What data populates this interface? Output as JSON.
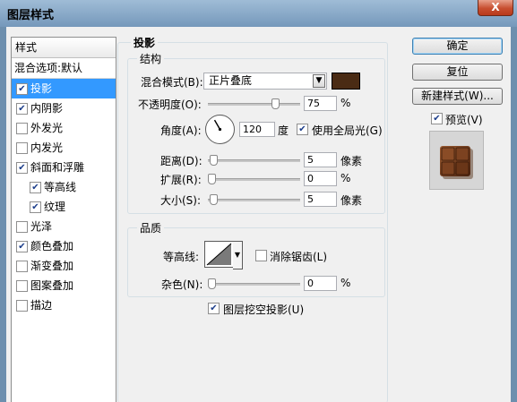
{
  "window": {
    "title": "图层样式",
    "close_label": "X"
  },
  "style_list": {
    "header": "样式",
    "blend": "混合选项:默认",
    "items": [
      {
        "label": "投影",
        "checked": true,
        "selected": true,
        "indent": false
      },
      {
        "label": "内阴影",
        "checked": true,
        "selected": false,
        "indent": false
      },
      {
        "label": "外发光",
        "checked": false,
        "selected": false,
        "indent": false
      },
      {
        "label": "内发光",
        "checked": false,
        "selected": false,
        "indent": false
      },
      {
        "label": "斜面和浮雕",
        "checked": true,
        "selected": false,
        "indent": false
      },
      {
        "label": "等高线",
        "checked": true,
        "selected": false,
        "indent": true
      },
      {
        "label": "纹理",
        "checked": true,
        "selected": false,
        "indent": true
      },
      {
        "label": "光泽",
        "checked": false,
        "selected": false,
        "indent": false
      },
      {
        "label": "颜色叠加",
        "checked": true,
        "selected": false,
        "indent": false
      },
      {
        "label": "渐变叠加",
        "checked": false,
        "selected": false,
        "indent": false
      },
      {
        "label": "图案叠加",
        "checked": false,
        "selected": false,
        "indent": false
      },
      {
        "label": "描边",
        "checked": false,
        "selected": false,
        "indent": false
      }
    ]
  },
  "drop_shadow": {
    "title": "投影",
    "structure": {
      "title": "结构",
      "blend_mode_label": "混合模式(B):",
      "blend_mode_value": "正片叠底",
      "shadow_color": "#4a2b14",
      "opacity_label": "不透明度(O):",
      "opacity_value": "75",
      "opacity_unit": "%",
      "opacity_fraction": 0.75,
      "angle_label": "角度(A):",
      "angle_value": "120",
      "angle_unit": "度",
      "use_global_light_label": "使用全局光(G)",
      "use_global_light": true,
      "distance_label": "距离(D):",
      "distance_value": "5",
      "distance_unit": "像素",
      "distance_fraction": 0.02,
      "spread_label": "扩展(R):",
      "spread_value": "0",
      "spread_unit": "%",
      "spread_fraction": 0,
      "size_label": "大小(S):",
      "size_value": "5",
      "size_unit": "像素",
      "size_fraction": 0.02
    },
    "quality": {
      "title": "品质",
      "contour_label": "等高线:",
      "anti_alias_label": "消除锯齿(L)",
      "anti_alias": false,
      "noise_label": "杂色(N):",
      "noise_value": "0",
      "noise_unit": "%",
      "noise_fraction": 0
    },
    "knockout_label": "图层挖空投影(U)",
    "knockout": true
  },
  "buttons": {
    "ok": "确定",
    "reset": "复位",
    "new_style": "新建样式(W)...",
    "preview_label": "预览(V)",
    "preview": true
  }
}
